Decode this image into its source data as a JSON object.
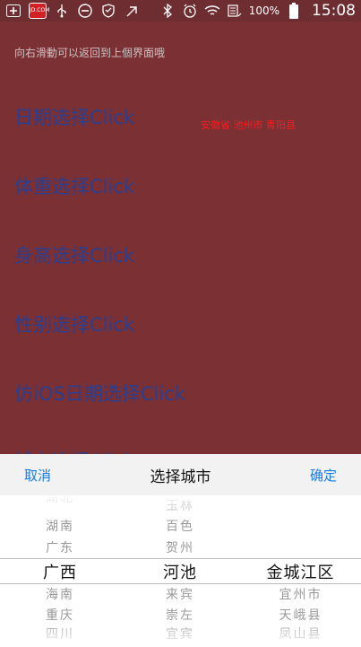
{
  "status_bar": {
    "app_icon_label": "JD.COM",
    "battery_text": "100%",
    "time": "15:08"
  },
  "screen": {
    "hint": "向右滑動可以返回到上個界面哦",
    "items": [
      "日期选择Click",
      "体重选择Click",
      "身高选择Click",
      "性别选择Click",
      "仿iOS日期选择Click",
      "城市选择Click"
    ],
    "result": "安徽省 池州市 青阳县"
  },
  "picker": {
    "cancel_label": "取消",
    "title": "选择城市",
    "confirm_label": "确定",
    "province": {
      "above": [
        "湖北",
        "湖南",
        "广东"
      ],
      "selected": "广西",
      "below": [
        "海南",
        "重庆",
        "四川"
      ]
    },
    "city": {
      "above": [
        "玉林",
        "百色",
        "贺州"
      ],
      "selected": "河池",
      "below": [
        "来宾",
        "崇左",
        "宜宾"
      ]
    },
    "district": {
      "above": [],
      "selected": "金城江区",
      "below": [
        "宜州市",
        "天峨县",
        "凤山县"
      ]
    }
  }
}
